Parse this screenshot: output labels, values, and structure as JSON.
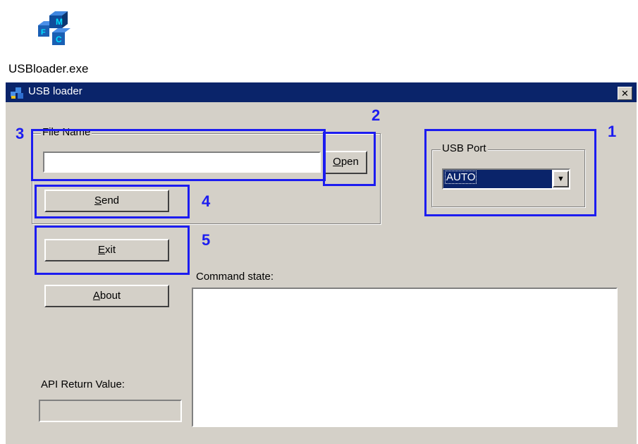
{
  "desktop": {
    "icon_label": "USBloader.exe",
    "icon": "usbloader-app-icon"
  },
  "window": {
    "title": "USB loader",
    "close_glyph": "✕",
    "title_icon": "usbloader-small-icon"
  },
  "file_group": {
    "legend": "File Name",
    "file_value": "",
    "open_mnemonic": "O",
    "open_rest": "pen"
  },
  "usb_group": {
    "legend": "USB Port",
    "selected": "AUTO",
    "arrow": "▼"
  },
  "buttons": {
    "send_mnemonic": "S",
    "send_rest": "end",
    "exit_mnemonic": "E",
    "exit_rest": "xit",
    "about_mnemonic": "A",
    "about_rest": "bout"
  },
  "command": {
    "label": "Command state:",
    "text": ""
  },
  "api": {
    "label": "API Return Value:",
    "value": ""
  },
  "annotations": {
    "n1": "1",
    "n2": "2",
    "n3": "3",
    "n4": "4",
    "n5": "5",
    "color": "#1c1cf0"
  }
}
